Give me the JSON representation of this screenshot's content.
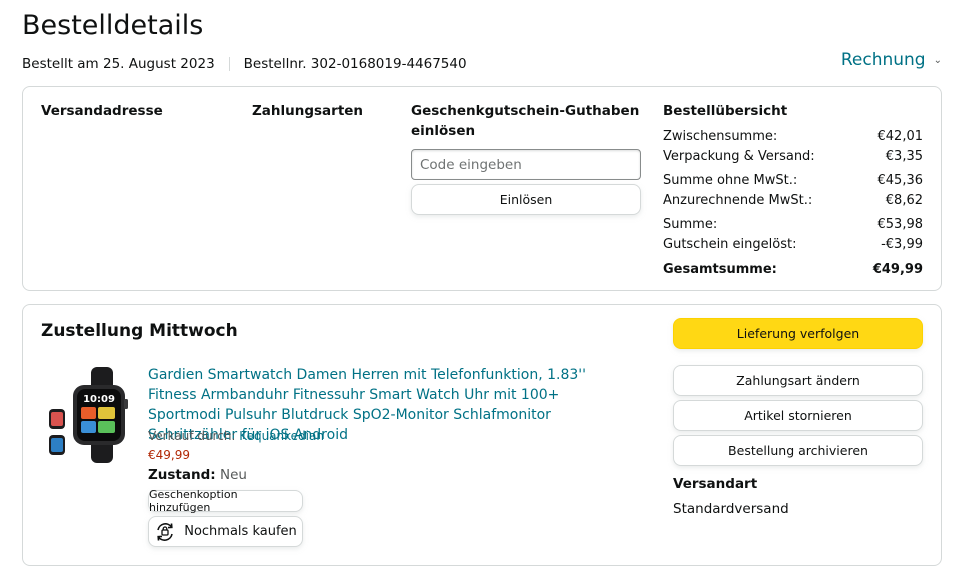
{
  "header": {
    "title": "Bestelldetails",
    "order_date": "Bestellt am 25. August 2023",
    "order_number": "Bestellnr. 302-0168019-4467540",
    "invoice_label": "Rechnung"
  },
  "order_info": {
    "shipping_address_label": "Versandadresse",
    "payment_methods_label": "Zahlungsarten",
    "gift_card_label_line1": "Geschenkgutschein-Guthaben",
    "gift_card_label_line2": "einlösen",
    "code_placeholder": "Code eingeben",
    "redeem_label": "Einlösen"
  },
  "summary": {
    "title": "Bestellübersicht",
    "rows": [
      {
        "label": "Zwischensumme:",
        "value": "€42,01"
      },
      {
        "label": "Verpackung & Versand:",
        "value": "€3,35"
      },
      {
        "label": "Summe ohne MwSt.:",
        "value": "€45,36"
      },
      {
        "label": "Anzurechnende MwSt.:",
        "value": "€8,62"
      },
      {
        "label": "Summe:",
        "value": "€53,98"
      },
      {
        "label": "Gutschein eingelöst:",
        "value": "-€3,99"
      }
    ],
    "total_label": "Gesamtsumme:",
    "total_value": "€49,99"
  },
  "delivery": {
    "title": "Zustellung Mittwoch",
    "product_title": "Gardien Smartwatch Damen Herren mit Telefonfunktion, 1.83'' Fitness Armbanduhr Fitnessuhr Smart Watch Uhr mit 100+ Sportmodi Pulsuhr Blutdruck SpO2-Monitor Schlafmonitor Schrittzähler für iOS Android",
    "sold_by_label": "Verkauf durch: ",
    "seller": "Kequankedian",
    "price": "€49,99",
    "condition_label": "Zustand:",
    "condition_value": "Neu",
    "gift_option_label": "Geschenkoption hinzufügen",
    "buy_again_label": "Nochmals kaufen",
    "watch_time": "10:09"
  },
  "actions": {
    "track_label": "Lieferung verfolgen",
    "change_payment_label": "Zahlungsart ändern",
    "cancel_label": "Artikel stornieren",
    "archive_label": "Bestellung archivieren",
    "shipping_type_label": "Versandart",
    "shipping_type_value": "Standardversand"
  },
  "colors": {
    "link": "#007185",
    "price": "#b12704",
    "primary_button": "#ffd814",
    "border": "#d5d9d9"
  }
}
